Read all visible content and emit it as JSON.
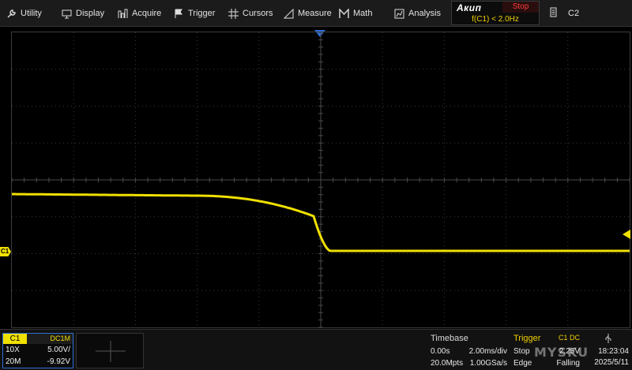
{
  "menu": {
    "utility": "Utility",
    "display": "Display",
    "acquire": "Acquire",
    "trigger": "Trigger",
    "cursors": "Cursors",
    "measure": "Measure",
    "math": "Math",
    "analysis": "Analysis"
  },
  "status": {
    "brand": "Акип",
    "run_state": "Stop",
    "trigger_condition": "f(C1) < 2.0Hz"
  },
  "c2_button": {
    "label": "C2"
  },
  "colors": {
    "ch1": "#f0e000",
    "accent_blue": "#2f6fd6",
    "stop_red": "#ff3c3c"
  },
  "channel": {
    "label": "C1",
    "coupling": "DC1M",
    "probe": "10X",
    "scale": "5.00V/",
    "bandwidth": "20M",
    "offset": "-9.92V",
    "marker": "C1"
  },
  "timebase": {
    "title": "Timebase",
    "delay": "0.00s",
    "scale": "2.00ms/div",
    "memory_depth": "20.0Mpts",
    "sample_rate": "1.00GSa/s"
  },
  "trigger": {
    "title": "Trigger",
    "source": "C1 DC",
    "mode": "Stop",
    "level": "2.25V",
    "type": "Edge",
    "slope": "Falling"
  },
  "system": {
    "time": "18:23:04",
    "date": "2025/5/11"
  },
  "watermark": "MYSKU"
}
